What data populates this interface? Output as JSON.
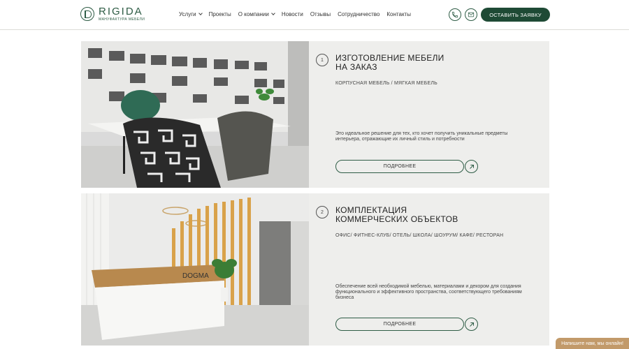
{
  "logo": {
    "name": "RIGIDA",
    "subtitle": "МАНУФАКТУРА МЕБЕЛИ"
  },
  "nav": {
    "items": [
      {
        "label": "Услуги",
        "dropdown": true
      },
      {
        "label": "Проекты",
        "dropdown": false
      },
      {
        "label": "О компании",
        "dropdown": true
      },
      {
        "label": "Новости",
        "dropdown": false
      },
      {
        "label": "Отзывы",
        "dropdown": false
      },
      {
        "label": "Сотрудничество",
        "dropdown": false
      },
      {
        "label": "Контакты",
        "dropdown": false
      }
    ]
  },
  "header": {
    "phone_icon": "phone-icon",
    "mail_icon": "mail-icon",
    "cta_label": "ОСТАВИТЬ ЗАЯВКУ"
  },
  "services": [
    {
      "number": "1",
      "title_line1": "ИЗГОТОВЛЕНИЕ МЕБЕЛИ",
      "title_line2": "НА ЗАКАЗ",
      "categories": "КОРПУСНАЯ МЕБЕЛЬ / МЯГКАЯ МЕБЕЛЬ",
      "description": "Это идеальное решение для тех, кто хочет получить уникальные предметы интерьера, отражающие их личный стиль и потребности",
      "button_label": "ПОДРОБНЕЕ"
    },
    {
      "number": "2",
      "title_line1": "КОМПЛЕКТАЦИЯ",
      "title_line2": "КОММЕРЧЕСКИХ ОБЪЕКТОВ",
      "categories": "ОФИС/ ФИТНЕС-КЛУБ/ ОТЕЛЬ/ ШКОЛА/ ШОУРУМ/ КАФЕ/ РЕСТОРАН",
      "description": "Обеспечение всей необходимой мебелью, материалами и декором для создания функционального и эффективного пространства, соответствующего требованиям бизнеса",
      "button_label": "ПОДРОБНЕЕ",
      "photo_sign": "DOGMA"
    }
  ],
  "chat": {
    "label": "Напишите нам, мы онлайн!"
  },
  "colors": {
    "brand_green": "#1e4a35",
    "card_bg": "#eeeeec",
    "chat_bg": "#c29a6a"
  }
}
